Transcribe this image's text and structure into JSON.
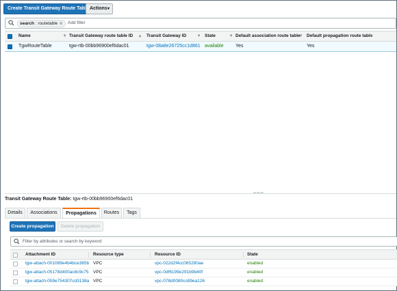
{
  "toolbar": {
    "create_label": "Create Transit Gateway Route Table",
    "actions_label": "Actions",
    "actions_caret": "▾"
  },
  "search": {
    "token_key": "search",
    "token_value": "routetable",
    "token_remove": "⊗",
    "add_filter": "Add filter"
  },
  "table": {
    "sort_icon": "▾",
    "sort_active_icon": "▴",
    "columns": {
      "name": "Name",
      "route_table_id": "Transit Gateway route table ID",
      "gateway_id": "Transit Gateway ID",
      "state": "State",
      "default_association": "Default association route table",
      "default_propagation": "Default propagation route table"
    },
    "rows": [
      {
        "name": "TgwRouteTable",
        "route_table_id": "tgw-rtb-00bb96900ef6dac01",
        "gateway_id": "tgw-08a8e26725cc1d861",
        "state": "available",
        "default_association": "Yes",
        "default_propagation": "Yes"
      }
    ]
  },
  "splitter": {
    "handle": "═══"
  },
  "detail": {
    "title_label": "Transit Gateway Route Table:",
    "title_value": "tgw-rtb-00bb96900ef6dac01",
    "tabs": [
      "Details",
      "Associations",
      "Propagations",
      "Routes",
      "Tags"
    ],
    "active_tab": "Propagations",
    "create_propagation": "Create propagation",
    "delete_propagation": "Delete propagation",
    "filter_placeholder": "Filter by attributes or search by keyword",
    "columns": {
      "attachment_id": "Attachment ID",
      "resource_type": "Resource type",
      "resource_id": "Resource ID",
      "state": "State"
    },
    "rows": [
      {
        "attachment_id": "tgw-attach-001089e4b4bce365b",
        "resource_type": "VPC",
        "resource_id": "vpc-022d2f4cc065280ae",
        "state": "enabled"
      },
      {
        "attachment_id": "tgw-attach-05178d400ac8c9c75",
        "resource_type": "VPC",
        "resource_id": "vpc-0df6199e291b9b40f",
        "state": "enabled"
      },
      {
        "attachment_id": "tgw-attach-059e754307cd3138a",
        "resource_type": "VPC",
        "resource_id": "vpc-078d0080cc89ea126",
        "state": "enabled"
      }
    ]
  },
  "colors": {
    "primary_button": "#1f73b7",
    "link": "#0073bb",
    "enabled_green": "#1d8102",
    "active_tab_accent": "#ec7211"
  }
}
